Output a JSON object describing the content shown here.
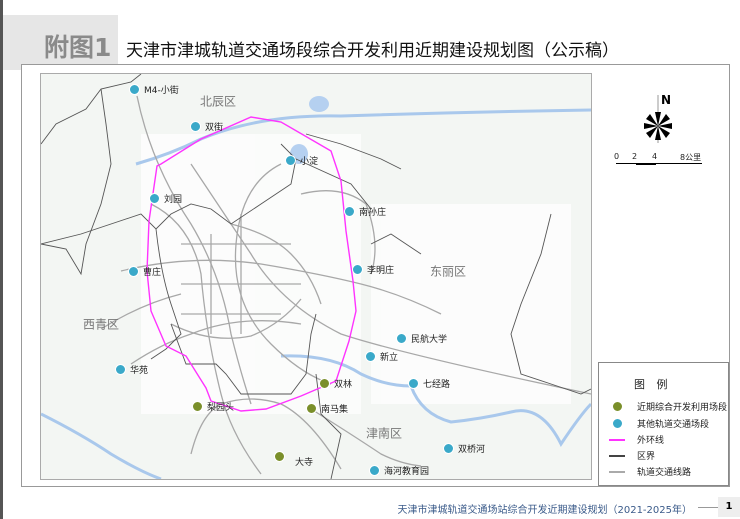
{
  "header": {
    "tag": "附图1",
    "title": "天津市津城轨道交通场段综合开发利用近期建设规划图（公示稿）"
  },
  "map": {
    "districts": [
      "北辰区",
      "东丽区",
      "西青区",
      "津南区"
    ],
    "stations_near": [
      "双林",
      "梨园头",
      "南马集",
      "大寺"
    ],
    "stations_other": [
      "M4-小街",
      "双街",
      "小淀",
      "刘园",
      "南孙庄",
      "曹庄",
      "李明庄",
      "民航大学",
      "新立",
      "七经路",
      "华苑",
      "双桥河",
      "海河教育园"
    ],
    "north_label": "N",
    "scale": {
      "ticks": [
        "0",
        "2",
        "4",
        "8公里"
      ]
    }
  },
  "legend": {
    "title": "图 例",
    "items": [
      {
        "label": "近期综合开发利用场段",
        "icon": "green-station-dot",
        "color": "#7a8f2a"
      },
      {
        "label": "其他轨道交通场段",
        "icon": "blue-station-dot",
        "color": "#3aa9c9"
      },
      {
        "label": "外环线",
        "icon": "pink-line",
        "color": "#ff33ff"
      },
      {
        "label": "区界",
        "icon": "dark-line",
        "color": "#444444"
      },
      {
        "label": "轨道交通线路",
        "icon": "gray-line",
        "color": "#aaaaaa"
      }
    ]
  },
  "footer": {
    "text": "天津市津城轨道交通场站综合开发近期建设规划（2021-2025年）",
    "page": "1"
  }
}
